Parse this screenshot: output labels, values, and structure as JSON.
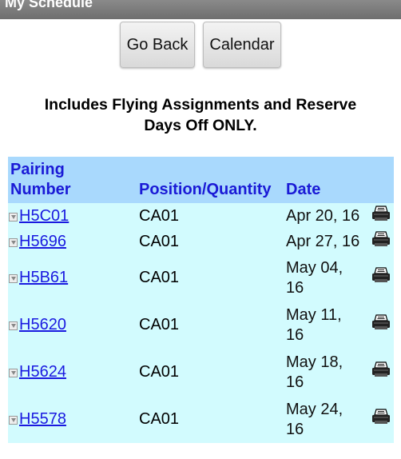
{
  "header": {
    "title": "My Schedule"
  },
  "buttons": {
    "go_back": "Go Back",
    "calendar": "Calendar"
  },
  "notice": {
    "line1": "Includes Flying Assignments and Reserve",
    "line2": "Days Off ONLY."
  },
  "table": {
    "headers": {
      "pairing_line1": "Pairing",
      "pairing_line2": "Number",
      "position": "Position/Quantity",
      "date": "Date"
    },
    "rows": [
      {
        "pairing": "H5C01",
        "position": "CA01",
        "date_line1": "Apr 20, 16",
        "date_line2": ""
      },
      {
        "pairing": "H5696",
        "position": "CA01",
        "date_line1": "Apr 27, 16",
        "date_line2": ""
      },
      {
        "pairing": "H5B61",
        "position": "CA01",
        "date_line1": "May 04,",
        "date_line2": "16"
      },
      {
        "pairing": "H5620",
        "position": "CA01",
        "date_line1": "May 11,",
        "date_line2": "16"
      },
      {
        "pairing": "H5624",
        "position": "CA01",
        "date_line1": "May 18,",
        "date_line2": "16"
      },
      {
        "pairing": "H5578",
        "position": "CA01",
        "date_line1": "May 24,",
        "date_line2": "16"
      }
    ]
  },
  "colors": {
    "header_bg": "#a9d9fd",
    "row_bg": "#d2fbfe",
    "header_text": "#1a1ad6",
    "link": "#1a1ae0"
  },
  "icons": {
    "expand": "expand-icon",
    "print": "printer-icon"
  }
}
